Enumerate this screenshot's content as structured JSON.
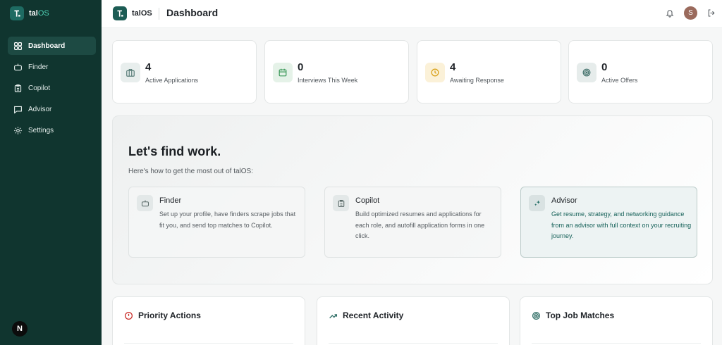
{
  "sidebar": {
    "brand_prefix": "tal",
    "brand_suffix": "OS",
    "items": [
      {
        "label": "Dashboard",
        "icon": "grid-icon",
        "active": true
      },
      {
        "label": "Finder",
        "icon": "robot-icon",
        "active": false
      },
      {
        "label": "Copilot",
        "icon": "clipboard-icon",
        "active": false
      },
      {
        "label": "Advisor",
        "icon": "message-icon",
        "active": false
      },
      {
        "label": "Settings",
        "icon": "gear-icon",
        "active": false
      }
    ],
    "badge": "N"
  },
  "header": {
    "brand": "talOS",
    "title": "Dashboard",
    "avatar_initial": "S",
    "icons": [
      "bell-icon",
      "logout-icon"
    ]
  },
  "stats": [
    {
      "value": "4",
      "label": "Active Applications",
      "icon": "briefcase-icon",
      "color": "#5b7f7a"
    },
    {
      "value": "0",
      "label": "Interviews This Week",
      "icon": "calendar-icon",
      "color": "#3f9a5c"
    },
    {
      "value": "4",
      "label": "Awaiting Response",
      "icon": "clock-icon",
      "color": "#d9a21b"
    },
    {
      "value": "0",
      "label": "Active Offers",
      "icon": "target-icon",
      "color": "#3e6e68"
    }
  ],
  "welcome": {
    "title": "Let's find work.",
    "subtitle": "Here's how to get the most out of talOS:",
    "features": [
      {
        "title": "Finder",
        "desc": "Set up your profile, have finders scrape jobs that fit you, and send top matches to Copilot.",
        "icon": "robot-icon"
      },
      {
        "title": "Copilot",
        "desc": "Build optimized resumes and applications for each role, and autofill application forms in one click.",
        "icon": "clipboard-icon"
      },
      {
        "title": "Advisor",
        "desc": "Get resume, strategy, and networking guidance from an advisor with full context on your recruiting journey.",
        "icon": "sparkle-icon"
      }
    ]
  },
  "panels": [
    {
      "title": "Priority Actions",
      "icon": "alert-circle-icon",
      "color": "#c9302c"
    },
    {
      "title": "Recent Activity",
      "icon": "trending-up-icon",
      "color": "#2f6e66"
    },
    {
      "title": "Top Job Matches",
      "icon": "target-icon",
      "color": "#2f6e66"
    }
  ],
  "colors": {
    "sidebar_bg": "#10352f",
    "sidebar_active": "#1d4a43",
    "accent": "#1e6b62",
    "page_bg": "#f6f7f7"
  }
}
